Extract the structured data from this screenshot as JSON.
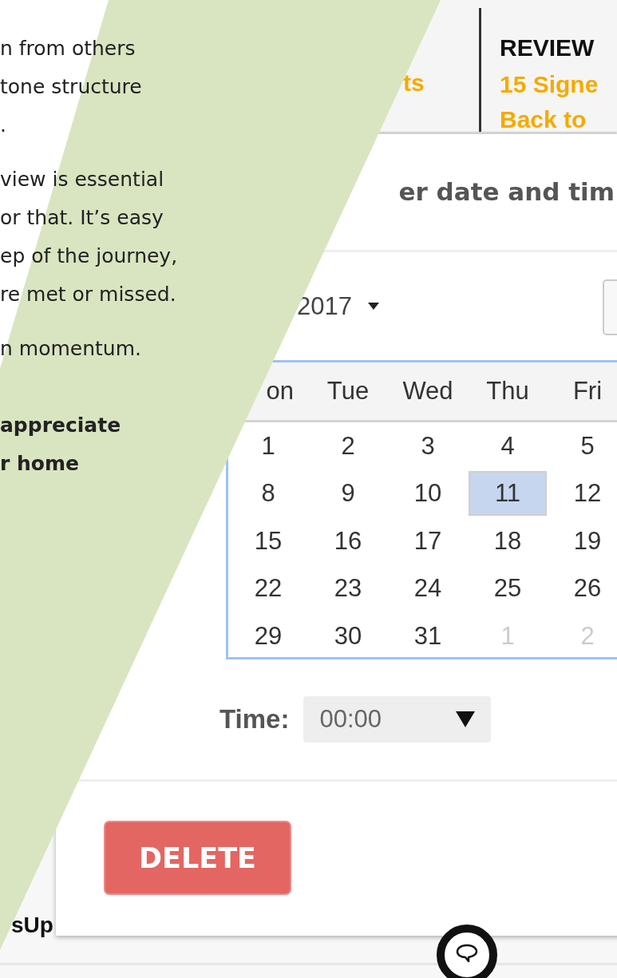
{
  "article": {
    "paragraphs": [
      {
        "bold": false,
        "lines": [
          "n from others",
          "tone structure",
          "."
        ]
      },
      {
        "bold": false,
        "lines": [
          "view is essential",
          "or that. It’s easy",
          "ep of the journey,",
          "re met or missed."
        ]
      },
      {
        "bold": false,
        "lines": [
          "n momentum."
        ]
      },
      {
        "bold": true,
        "lines": [
          "appreciate",
          "r home"
        ]
      }
    ]
  },
  "header": {
    "link_fragment": "ts",
    "review_title": "REVIEW",
    "review_lines": [
      "15 Signe",
      "Back to"
    ]
  },
  "dialog": {
    "title": "er date and tim",
    "year": "2017",
    "weekdays": [
      "on",
      "Tue",
      "Wed",
      "Thu",
      "Fri"
    ],
    "weeks": [
      [
        {
          "day": "1",
          "selected": false,
          "outside": false
        },
        {
          "day": "2",
          "selected": false,
          "outside": false
        },
        {
          "day": "3",
          "selected": false,
          "outside": false
        },
        {
          "day": "4",
          "selected": false,
          "outside": false
        },
        {
          "day": "5",
          "selected": false,
          "outside": false
        }
      ],
      [
        {
          "day": "8",
          "selected": false,
          "outside": false
        },
        {
          "day": "9",
          "selected": false,
          "outside": false
        },
        {
          "day": "10",
          "selected": false,
          "outside": false
        },
        {
          "day": "11",
          "selected": true,
          "outside": false
        },
        {
          "day": "12",
          "selected": false,
          "outside": false
        }
      ],
      [
        {
          "day": "15",
          "selected": false,
          "outside": false
        },
        {
          "day": "16",
          "selected": false,
          "outside": false
        },
        {
          "day": "17",
          "selected": false,
          "outside": false
        },
        {
          "day": "18",
          "selected": false,
          "outside": false
        },
        {
          "day": "19",
          "selected": false,
          "outside": false
        }
      ],
      [
        {
          "day": "22",
          "selected": false,
          "outside": false
        },
        {
          "day": "23",
          "selected": false,
          "outside": false
        },
        {
          "day": "24",
          "selected": false,
          "outside": false
        },
        {
          "day": "25",
          "selected": false,
          "outside": false
        },
        {
          "day": "26",
          "selected": false,
          "outside": false
        }
      ],
      [
        {
          "day": "29",
          "selected": false,
          "outside": false
        },
        {
          "day": "30",
          "selected": false,
          "outside": false
        },
        {
          "day": "31",
          "selected": false,
          "outside": false
        },
        {
          "day": "1",
          "selected": false,
          "outside": true
        },
        {
          "day": "2",
          "selected": false,
          "outside": true
        }
      ]
    ],
    "time_label": "Time:",
    "time_value": "00:00",
    "delete_button": "DELETE"
  },
  "fragment_text": "sUp"
}
